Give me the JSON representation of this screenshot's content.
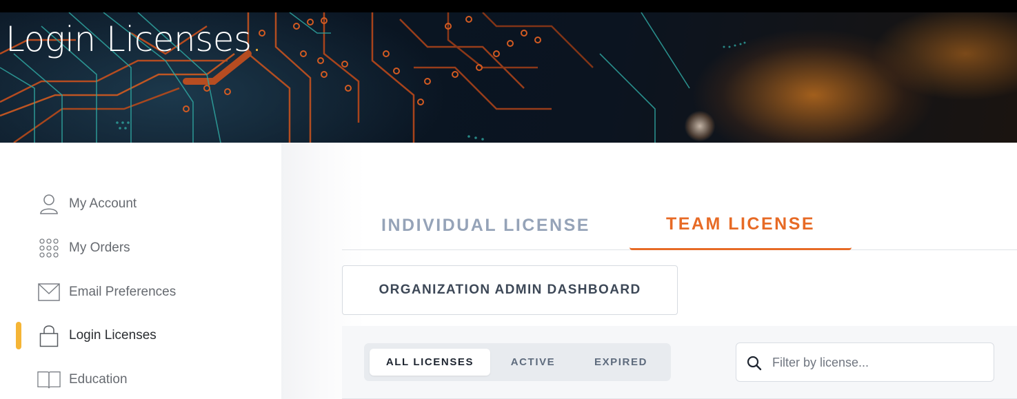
{
  "header": {
    "title": "Login Licenses",
    "title_dot": ".",
    "accent_color": "#f5b536"
  },
  "sidebar": {
    "items": [
      {
        "label": "My Account",
        "icon": "user-icon",
        "active": false
      },
      {
        "label": "My Orders",
        "icon": "grid-dots-icon",
        "active": false
      },
      {
        "label": "Email Preferences",
        "icon": "envelope-icon",
        "active": false
      },
      {
        "label": "Login Licenses",
        "icon": "lock-icon",
        "active": true
      },
      {
        "label": "Education",
        "icon": "book-icon",
        "active": false
      }
    ]
  },
  "tabs": {
    "individual": "INDIVIDUAL LICENSE",
    "team": "TEAM LICENSE",
    "selected": "team",
    "accent_color": "#e76a25"
  },
  "org_admin_button": "ORGANIZATION ADMIN DASHBOARD",
  "filters": {
    "options": [
      "ALL LICENSES",
      "ACTIVE",
      "EXPIRED"
    ],
    "selected": "ALL LICENSES"
  },
  "search": {
    "placeholder": "Filter by license...",
    "value": ""
  }
}
